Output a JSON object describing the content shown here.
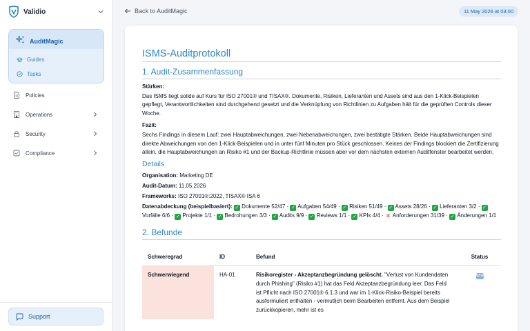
{
  "brand": {
    "name": "Validio"
  },
  "sidebar": {
    "active_section": {
      "label": "AuditMagic",
      "sub_items": [
        {
          "label": "Guides"
        },
        {
          "label": "Tasks"
        }
      ]
    },
    "items": [
      {
        "label": "Policies",
        "icon": "document-icon",
        "has_children": false
      },
      {
        "label": "Operations",
        "icon": "building-icon",
        "has_children": true
      },
      {
        "label": "Security",
        "icon": "lock-icon",
        "has_children": true
      },
      {
        "label": "Compliance",
        "icon": "shield-check-icon",
        "has_children": true
      }
    ],
    "support_label": "Support"
  },
  "topbar": {
    "back_label": "Back to AuditMagic",
    "date": "11 May 2026 at 03:00"
  },
  "document": {
    "title": "ISMS-Auditprotokoll",
    "section1_title": "1. Audit-Zusammenfassung",
    "strengths_label": "Stärken:",
    "strengths_text": "Das ISMS liegt solide auf Kurs für ISO 27001® und TISAX®. Dokumente, Risiken, Lieferanten und Assets sind aus den 1-Klick-Beispielen gepflegt, Verantwortlichkeiten sind durchgehend gesetzt und die Verknüpfung von Richtlinien zu Aufgaben hält für die geprüften Controls dieser Woche.",
    "conclusion_label": "Fazit:",
    "conclusion_text": "Sechs Findings in diesem Lauf: zwei Hauptabweichungen, zwei Nebenabweichungen, zwei bestätigte Stärken. Beide Hauptabweichungen sind direkte Abweichungen von den 1-Klick-Beispielen und in unter fünf Minuten pro Stück geschlossen. Keines der Findings blockiert die Zertifizierung allein, die Hauptabweichungen an Risiko #1 und der Backup-Richtlinie müssen aber vor dem nächsten externen Auditfenster bearbeitet werden.",
    "details_title": "Details",
    "org_label": "Organisation:",
    "org_value": "Marketing DE",
    "date_label": "Audit-Datum:",
    "date_value": "11.05.2026",
    "frameworks_label": "Frameworks:",
    "frameworks_value": "ISO 27001®:2022, TISAX® ISA 6",
    "coverage_label": "Datenabdeckung (beispielbasiert):",
    "coverage": [
      {
        "label": "Dokumente 52/47",
        "ok": true
      },
      {
        "label": "Aufgaben 54/49",
        "ok": true
      },
      {
        "label": "Risiken 51/49",
        "ok": true
      },
      {
        "label": "Assets 28/26",
        "ok": true
      },
      {
        "label": "Lieferanten 3/2",
        "ok": true
      },
      {
        "label": "Vorfälle 6/6",
        "ok": true
      },
      {
        "label": "Projekte 1/1",
        "ok": true
      },
      {
        "label": "Bedrohungen 3/3",
        "ok": true
      },
      {
        "label": "Audits 9/9",
        "ok": true
      },
      {
        "label": "Reviews 1/1",
        "ok": true
      },
      {
        "label": "KPIs 4/4",
        "ok": true
      },
      {
        "label": "Anforderungen 31/39",
        "ok": false
      },
      {
        "label": "Änderungen 1/1",
        "ok": true
      }
    ],
    "section2_title": "2. Befunde",
    "table": {
      "headers": {
        "severity": "Schweregrad",
        "id": "ID",
        "finding": "Befund",
        "status": "Status"
      },
      "rows": [
        {
          "severity": "Schwerwiegend",
          "id": "HA-01",
          "finding_title": "Risikoregister - Akzeptanzbegründung gelöscht.",
          "finding_text": " \"Verlust von Kundendaten durch Phishing\" (Risiko #1) hat das Feld Akzeptanzbegründung leer. Das Feld ist Pflicht nach ISO 27001® 6.1.3 und war im 1-Klick-Risiko-Beispiel bereits ausformuliert enthalten - vermutlich beim Bearbeiten entfernt. Aus dem Beispiel zurückkopieren, mehr ist es",
          "status": "NEW"
        }
      ]
    }
  }
}
